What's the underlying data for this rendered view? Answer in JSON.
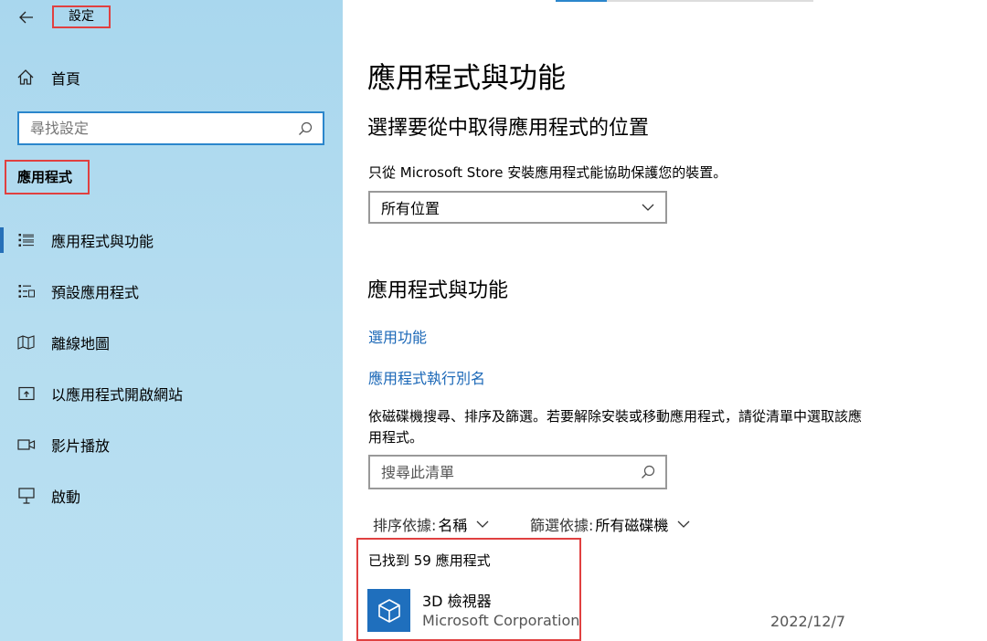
{
  "sidebar": {
    "app_title": "設定",
    "home_label": "首頁",
    "search_placeholder": "尋找設定",
    "section_title": "應用程式",
    "items": [
      {
        "label": "應用程式與功能",
        "icon": "apps-features-icon",
        "active": true
      },
      {
        "label": "預設應用程式",
        "icon": "default-apps-icon"
      },
      {
        "label": "離線地圖",
        "icon": "offline-maps-icon"
      },
      {
        "label": "以應用程式開啟網站",
        "icon": "apps-for-websites-icon"
      },
      {
        "label": "影片播放",
        "icon": "video-playback-icon"
      },
      {
        "label": "啟動",
        "icon": "startup-icon"
      }
    ]
  },
  "main": {
    "title": "應用程式與功能",
    "choose_heading": "選擇要從中取得應用程式的位置",
    "choose_desc": "只從 Microsoft Store 安裝應用程式能協助保護您的裝置。",
    "location_dropdown": "所有位置",
    "apps_heading": "應用程式與功能",
    "link_optional": "選用功能",
    "link_alias": "應用程式執行別名",
    "search_desc": "依磁碟機搜尋、排序及篩選。若要解除安裝或移動應用程式，請從清單中選取該應用程式。",
    "list_search_placeholder": "搜尋此清單",
    "sort_key": "排序依據:",
    "sort_value": "名稱",
    "filter_key": "篩選依據:",
    "filter_value": "所有磁碟機",
    "found_count": "已找到 59 應用程式",
    "apps": [
      {
        "name": "3D 檢視器",
        "publisher": "Microsoft Corporation",
        "date": "2022/12/7",
        "icon": "3d-viewer-icon"
      }
    ]
  },
  "colors": {
    "accent": "#2b86cc",
    "link": "#1a67b7",
    "highlight_border": "#e04040",
    "app_tile": "#1f6fbd"
  }
}
